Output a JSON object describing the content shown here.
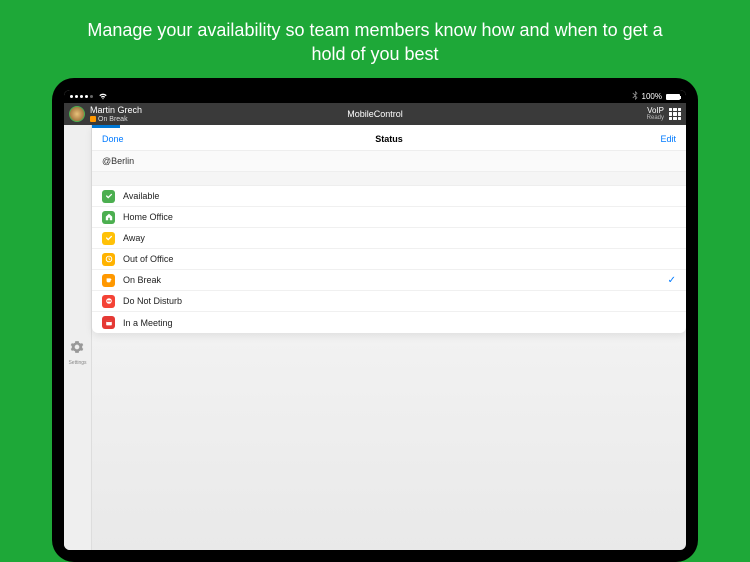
{
  "promo": "Manage your availability so team members know how and when to get a hold of you best",
  "ios": {
    "battery": "100%"
  },
  "header": {
    "user_name": "Martin Grech",
    "user_status": "On Break",
    "app_title": "MobileControl",
    "voip_label": "VoIP",
    "voip_state": "Ready"
  },
  "rail": {
    "settings": "Settings"
  },
  "panel": {
    "done": "Done",
    "title": "Status",
    "edit": "Edit",
    "location": "@Berlin"
  },
  "statuses": [
    {
      "label": "Available",
      "selected": false
    },
    {
      "label": "Home Office",
      "selected": false
    },
    {
      "label": "Away",
      "selected": false
    },
    {
      "label": "Out of Office",
      "selected": false
    },
    {
      "label": "On Break",
      "selected": true
    },
    {
      "label": "Do Not Disturb",
      "selected": false
    },
    {
      "label": "In a Meeting",
      "selected": false
    }
  ],
  "checkmark": "✓"
}
